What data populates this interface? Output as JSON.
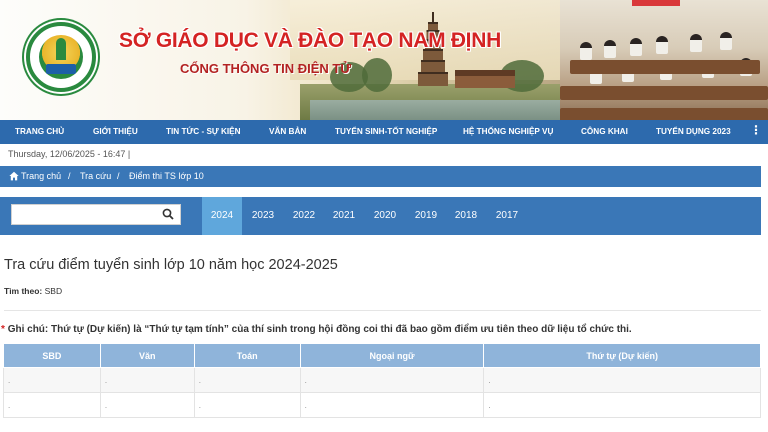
{
  "header": {
    "title": "SỞ GIÁO DỤC VÀ ĐÀO TẠO NAM ĐỊNH",
    "subtitle": "CỔNG THÔNG TIN ĐIỆN TỬ"
  },
  "nav": {
    "items": [
      "TRANG CHỦ",
      "GIỚI THIỆU",
      "TIN TỨC - SỰ KIỆN",
      "VĂN BẢN",
      "TUYỂN SINH-TỐT NGHIỆP",
      "HỆ THỐNG NGHIỆP VỤ",
      "CÔNG KHAI",
      "TUYỂN DỤNG 2023"
    ],
    "more": "⋮"
  },
  "datebar": {
    "text": "Thursday, 12/06/2025 - 16:47   |"
  },
  "breadcrumb": {
    "home": "Trang chủ",
    "sep": "/",
    "lookup": "Tra cứu",
    "current": "Điểm thi TS lớp 10"
  },
  "search": {
    "value": "",
    "placeholder": ""
  },
  "years": [
    "2024",
    "2023",
    "2022",
    "2021",
    "2020",
    "2019",
    "2018",
    "2017"
  ],
  "active_year": "2024",
  "content": {
    "heading": "Tra cứu điểm tuyển sinh lớp 10 năm học 2024-2025",
    "searchby_label": "Tìm theo:",
    "searchby_value": "SBD",
    "note_star": "*",
    "note": "Ghi chú: Thứ tự (Dự kiến) là “Thứ tự tạm tính” của thí sinh trong hội đồng coi thi đã bao gồm điểm ưu tiên theo dữ liệu tổ chức thi."
  },
  "table": {
    "headers": [
      "SBD",
      "Văn",
      "Toán",
      "Ngoại ngữ",
      "Thứ tự (Dự kiến)"
    ],
    "rows": [
      [
        ".",
        ".",
        ".",
        ".",
        "."
      ],
      [
        ".",
        ".",
        ".",
        ".",
        "."
      ]
    ]
  },
  "colors": {
    "nav": "#2d6aad",
    "bar": "#3a77b7",
    "active_year": "#5fa7dc",
    "table_header": "#8fb4da",
    "title_red": "#d42323"
  }
}
